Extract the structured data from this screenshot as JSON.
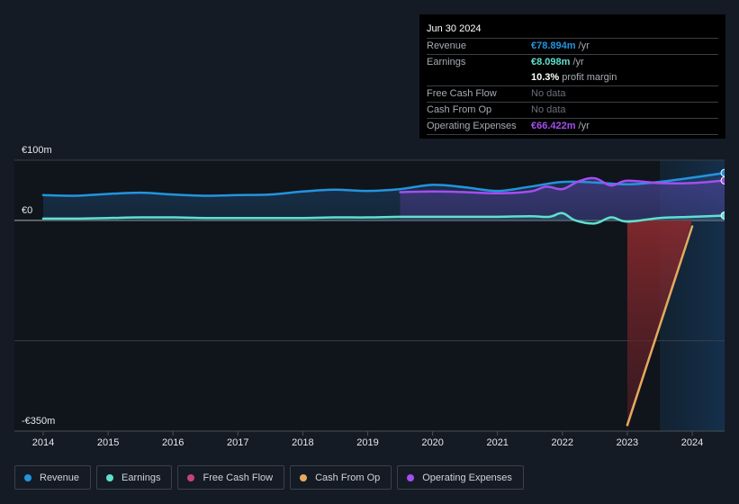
{
  "tooltip": {
    "date": "Jun 30 2024",
    "rows": [
      {
        "label": "Revenue",
        "value": "€78.894m",
        "unit": "/yr",
        "color": "#2394df"
      },
      {
        "label": "Earnings",
        "value": "€8.098m",
        "unit": "/yr",
        "color": "#5fe0cf"
      },
      {
        "label": "",
        "value": "10.3%",
        "unit": "profit margin",
        "color": "#ffffff"
      },
      {
        "label": "Free Cash Flow",
        "value": "No data",
        "unit": "",
        "color": "#6a6f77"
      },
      {
        "label": "Cash From Op",
        "value": "No data",
        "unit": "",
        "color": "#6a6f77"
      },
      {
        "label": "Operating Expenses",
        "value": "€66.422m",
        "unit": "/yr",
        "color": "#a44ef0"
      }
    ]
  },
  "legend": [
    {
      "label": "Revenue",
      "color": "#2394df"
    },
    {
      "label": "Earnings",
      "color": "#5fe0cf"
    },
    {
      "label": "Free Cash Flow",
      "color": "#c4437c"
    },
    {
      "label": "Cash From Op",
      "color": "#e6a95f"
    },
    {
      "label": "Operating Expenses",
      "color": "#a44ef0"
    }
  ],
  "chart_data": {
    "type": "line",
    "title": "",
    "xlabel": "",
    "ylabel": "",
    "currency_unit": "€m",
    "ylim": [
      -350,
      100
    ],
    "xlim": [
      2013.65,
      2024.5
    ],
    "y_tick_labels": [
      {
        "value": 100,
        "label": "€100m"
      },
      {
        "value": 0,
        "label": "€0"
      },
      {
        "value": -350,
        "label": "-€350m"
      }
    ],
    "y_gridlines": [
      100,
      0,
      -200
    ],
    "x_ticks": [
      2014,
      2015,
      2016,
      2017,
      2018,
      2019,
      2020,
      2021,
      2022,
      2023,
      2024
    ],
    "x_tick_labels": [
      "2014",
      "2015",
      "2016",
      "2017",
      "2018",
      "2019",
      "2020",
      "2021",
      "2022",
      "2023",
      "2024"
    ],
    "highlight_region": [
      2023.5,
      2024.5
    ],
    "grid": true,
    "legend_position": "bottom-left",
    "series": [
      {
        "name": "Revenue",
        "color": "#2394df",
        "x": [
          2014,
          2014.5,
          2015,
          2015.5,
          2016,
          2016.5,
          2017,
          2017.5,
          2018,
          2018.5,
          2019,
          2019.5,
          2020,
          2020.5,
          2021,
          2021.5,
          2022,
          2022.5,
          2023,
          2023.5,
          2024,
          2024.5
        ],
        "values": [
          42,
          41,
          44,
          46,
          43,
          41,
          42,
          43,
          48,
          51,
          49,
          52,
          59,
          55,
          49,
          56,
          64,
          63,
          60,
          64,
          71,
          78.9
        ]
      },
      {
        "name": "Earnings",
        "color": "#5fe0cf",
        "x": [
          2014,
          2014.5,
          2015,
          2015.5,
          2016,
          2016.5,
          2017,
          2017.5,
          2018,
          2018.5,
          2019,
          2019.5,
          2020,
          2020.5,
          2021,
          2021.5,
          2021.8,
          2022,
          2022.2,
          2022.5,
          2022.75,
          2023,
          2023.5,
          2024,
          2024.5
        ],
        "values": [
          3,
          3,
          4,
          5,
          5,
          4,
          4,
          4,
          4,
          5,
          5,
          6,
          6,
          6,
          6,
          7,
          6,
          12,
          0,
          -5,
          5,
          -2,
          4,
          6,
          8.1
        ]
      },
      {
        "name": "Free Cash Flow",
        "color": "#c4437c",
        "x": [
          2023,
          2023,
          2024
        ],
        "values": [
          0,
          -350,
          0
        ]
      },
      {
        "name": "Cash From Op",
        "color": "#e6a95f",
        "x": [
          2023,
          2024
        ],
        "values": [
          -340,
          -10
        ]
      },
      {
        "name": "Operating Expenses",
        "color": "#a44ef0",
        "x": [
          2019.5,
          2020,
          2020.5,
          2021,
          2021.5,
          2021.75,
          2022,
          2022.25,
          2022.5,
          2022.75,
          2023,
          2023.5,
          2024,
          2024.5
        ],
        "values": [
          47,
          48,
          47,
          45,
          48,
          56,
          52,
          65,
          70,
          58,
          66,
          62,
          62,
          66.4
        ]
      }
    ]
  }
}
